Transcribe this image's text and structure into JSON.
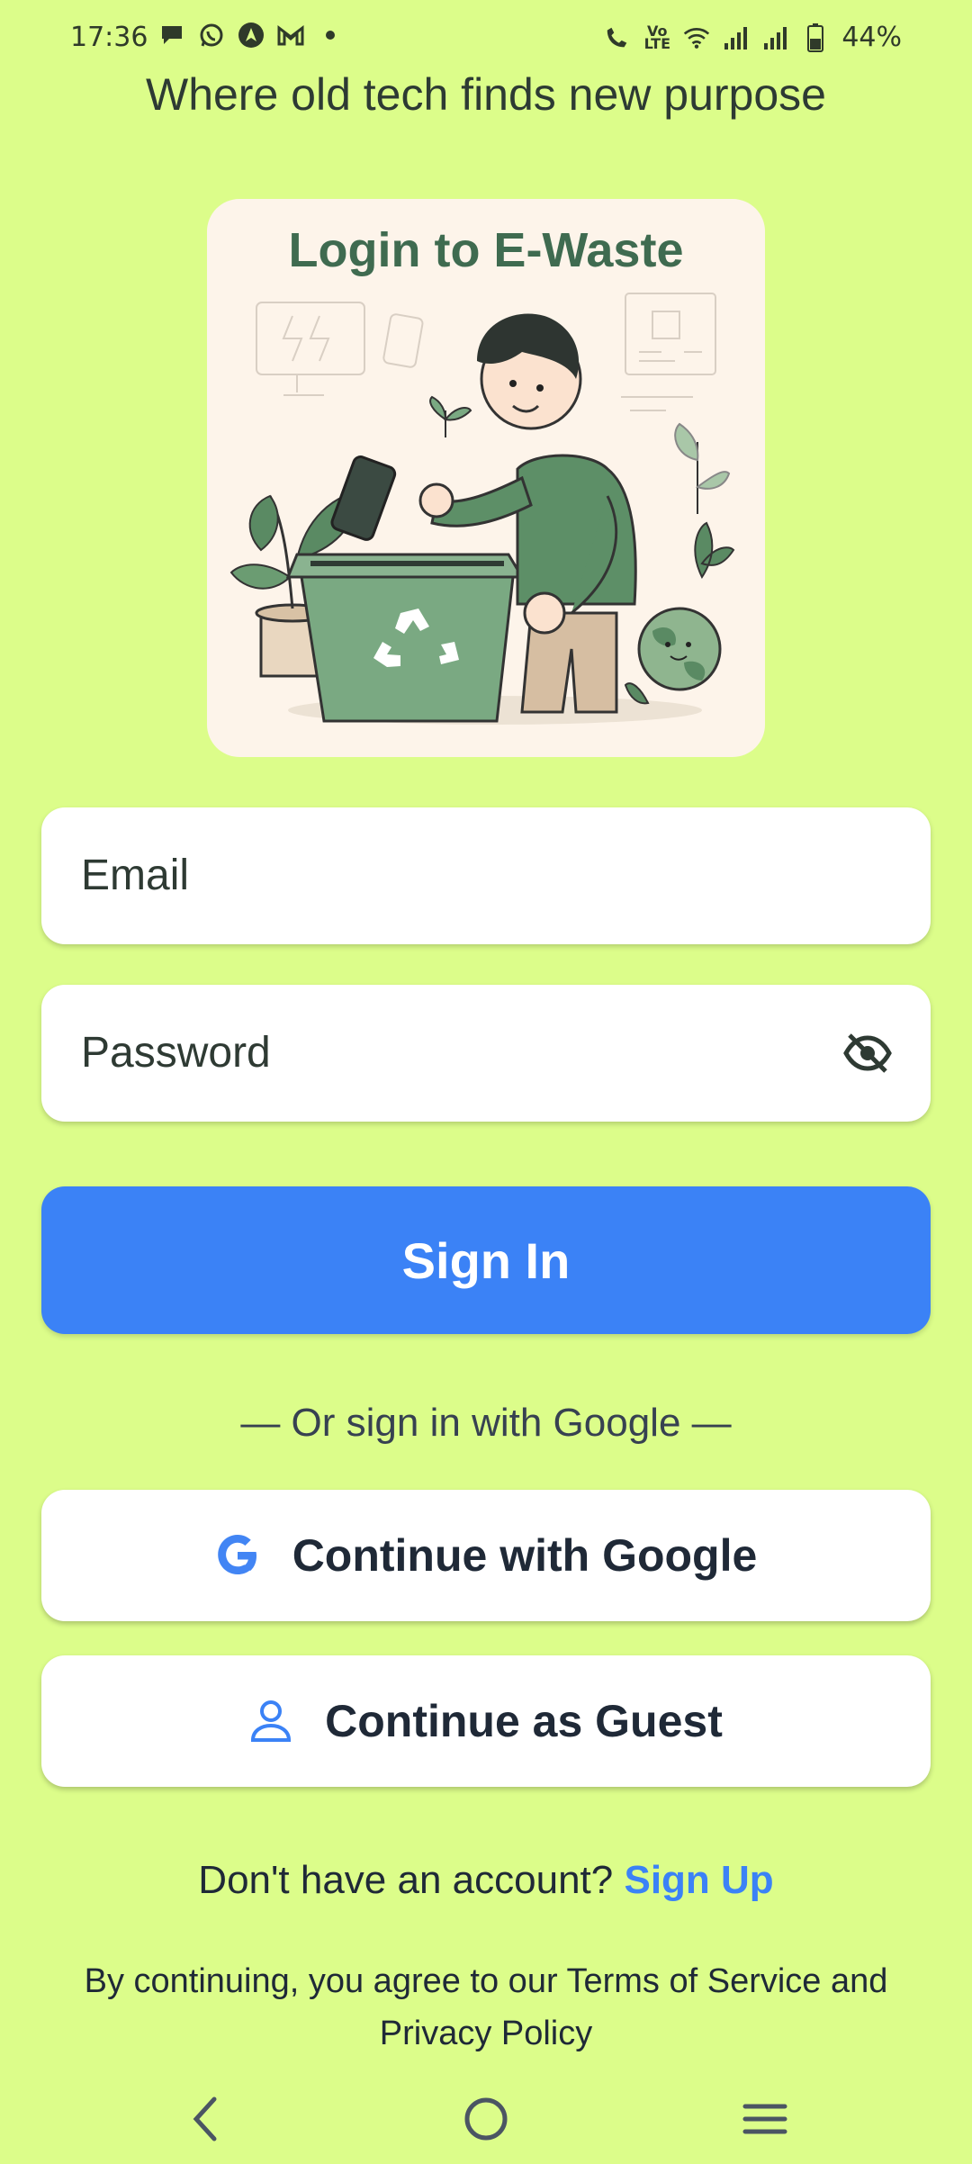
{
  "status_bar": {
    "time": "17:36",
    "battery": "44%",
    "left_icons": [
      "chat-bubble-icon",
      "whatsapp-icon",
      "navigation-app-icon",
      "gmail-icon",
      "dot-icon"
    ],
    "right_icons": [
      "wifi-calling-icon",
      "volte-icon",
      "wifi-icon",
      "signal-icon",
      "signal-icon",
      "battery-icon"
    ]
  },
  "tagline": "Where old tech finds new purpose",
  "hero": {
    "title": "Login to E-Waste"
  },
  "form": {
    "email_placeholder": "Email",
    "password_placeholder": "Password",
    "password_toggle_icon": "eye-off-icon",
    "sign_in_label": "Sign In"
  },
  "alt_login": {
    "divider": "— Or sign in with Google —",
    "google_label": "Continue with Google",
    "guest_label": "Continue as Guest"
  },
  "signup": {
    "prompt": "Don't have an account?",
    "link": "Sign Up"
  },
  "terms": {
    "line1": "By continuing, you agree to our Terms of Service and",
    "line2": "Privacy Policy"
  },
  "colors": {
    "background": "#dcfd8a",
    "primary": "#3b82f6",
    "hero_bg": "#fdf4ea",
    "hero_title": "#3f6b50"
  },
  "nav_bar": {
    "icons": [
      "back-icon",
      "home-icon",
      "recents-icon"
    ]
  }
}
